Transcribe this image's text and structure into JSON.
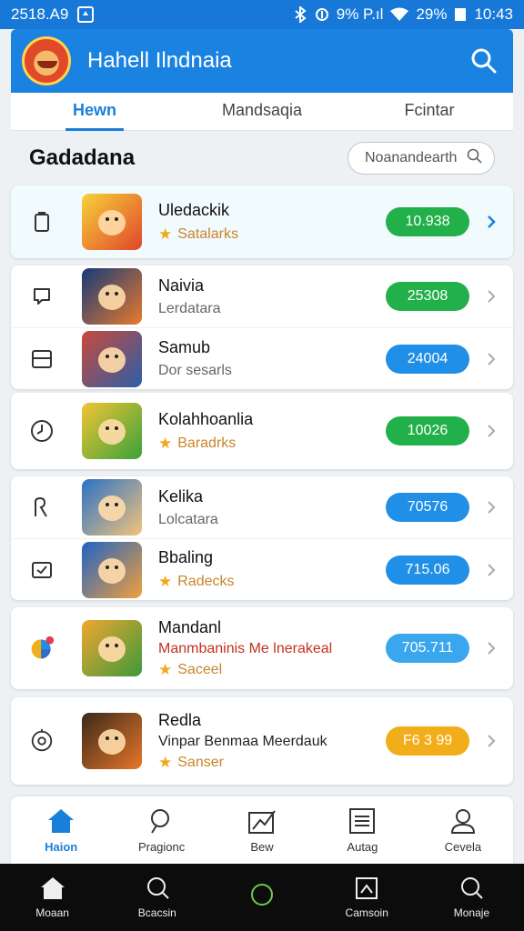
{
  "status_bar": {
    "time": "2518.A9",
    "signal": "9% P.ıl",
    "battery": "29%",
    "clock": "10:43"
  },
  "header": {
    "title": "Hahell Ilndnaia"
  },
  "tabs": [
    {
      "label": "Hewn",
      "active": true
    },
    {
      "label": "Mandsaqia",
      "active": false
    },
    {
      "label": "Fcintar",
      "active": false
    }
  ],
  "section": {
    "title": "Gadadana",
    "filter_placeholder": "Noanandearth"
  },
  "items": [
    {
      "icon": "bookmark-icon",
      "name": "Uledackik",
      "sub": "Satalarks",
      "sub_style": "gold",
      "star": true,
      "value": "10.938",
      "pill": "green"
    },
    {
      "icon": "chat-icon",
      "name": "Naivia",
      "sub": "Lerdatara",
      "sub_style": "gray",
      "star": false,
      "value": "25308",
      "pill": "green"
    },
    {
      "icon": "window-icon",
      "name": "Samub",
      "sub": "Dor sesarls",
      "sub_style": "gray",
      "star": false,
      "value": "24004",
      "pill": "blue"
    },
    {
      "icon": "clock-icon",
      "name": "Kolahhoanlia",
      "sub": "Baradrks",
      "sub_style": "gold",
      "star": true,
      "value": "10026",
      "pill": "green"
    },
    {
      "icon": "tag-icon",
      "name": "Kelika",
      "sub": "Lolcatara",
      "sub_style": "gray",
      "star": false,
      "value": "70576",
      "pill": "blue"
    },
    {
      "icon": "checkbox-icon",
      "name": "Bbaling",
      "sub": "Radecks",
      "sub_style": "gold",
      "star": true,
      "value": "715.06",
      "pill": "blue"
    },
    {
      "icon": "color-wheel-icon",
      "name": "Mandanl",
      "sub": "Manmbaninis Me lnerakeal",
      "sub2": "Saceel",
      "sub_style": "red",
      "star": true,
      "value": "705.711",
      "pill": "lightblue"
    },
    {
      "icon": "target-icon",
      "name": "Redla",
      "sub": "Vinpar Benmaa Meerdauk",
      "sub2": "Sanser",
      "sub_style": "dark",
      "star": true,
      "value": "F6 3 99",
      "pill": "amber"
    }
  ],
  "bottom_nav": [
    {
      "label": "Haion",
      "icon": "home-icon",
      "active": true
    },
    {
      "label": "Pragionc",
      "icon": "search-icon",
      "active": false
    },
    {
      "label": "Bew",
      "icon": "chart-icon",
      "active": false
    },
    {
      "label": "Autag",
      "icon": "list-icon",
      "active": false
    },
    {
      "label": "Cevela",
      "icon": "profile-icon",
      "active": false
    }
  ],
  "system_nav": [
    {
      "label": "Moaan",
      "icon": "home-icon"
    },
    {
      "label": "Bcacsin",
      "icon": "search-icon"
    },
    {
      "label": "",
      "icon": "circle-icon"
    },
    {
      "label": "Camsoin",
      "icon": "camera-icon"
    },
    {
      "label": "Monaje",
      "icon": "search-icon"
    }
  ],
  "colors": {
    "primary": "#1a82e0",
    "green": "#22b04a",
    "blue": "#1f8fe8",
    "amber": "#f2ae1a",
    "star": "#f2a81c"
  }
}
